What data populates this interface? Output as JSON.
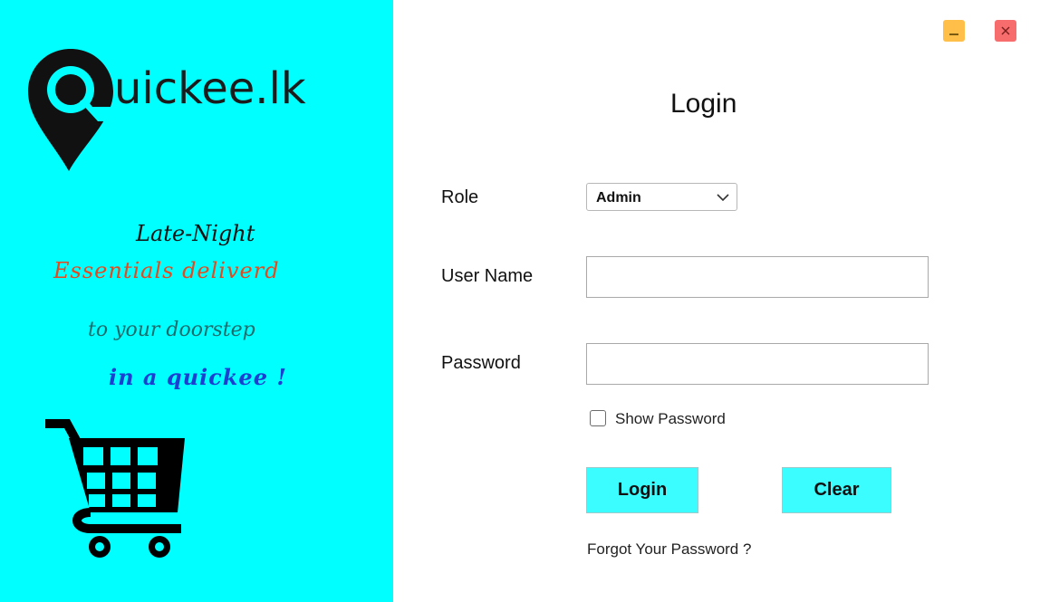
{
  "brand": {
    "logo_text": "uickee.lk",
    "logo_letter": "Q"
  },
  "tagline": {
    "line1": "Late-Night",
    "line2": "Essentials deliverd",
    "line3": "to your doorstep",
    "line4": "in a quickee !"
  },
  "window": {
    "minimize_icon": "minimize-icon",
    "close_icon": "close-icon"
  },
  "form": {
    "title": "Login",
    "role_label": "Role",
    "role_value": "Admin",
    "username_label": "User Name",
    "username_value": "",
    "password_label": "Password",
    "password_value": "",
    "show_password_label": "Show Password",
    "show_password_checked": false,
    "login_button": "Login",
    "clear_button": "Clear",
    "forgot_link": "Forgot Your Password ?"
  },
  "colors": {
    "left_panel_bg": "#00ffff",
    "button_bg": "#3bfdff",
    "minimize_btn": "#ffbf48",
    "close_btn": "#f76c6c",
    "tagline_orange": "#e8481b",
    "tagline_teal": "#1d6b6b",
    "tagline_blue": "#1a3fd1"
  }
}
